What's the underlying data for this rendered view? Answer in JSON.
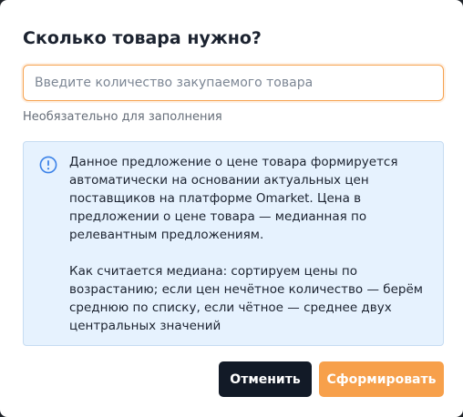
{
  "dialog": {
    "title": "Сколько товара нужно?",
    "quantity_input": {
      "value": "",
      "placeholder": "Введите количество закупаемого товара"
    },
    "hint": "Необязательно для заполнения",
    "info": {
      "icon": "alert-circle-icon",
      "paragraph_1": "Данное предложение о цене товара формируется\nавтоматически на основании актуальных цен\nпоставщиков на платформе Omarket. Цена в\nпредложении о цене товара — медианная по\nрелевантным предложениям.",
      "paragraph_2": "Как считается медиана: сортируем цены по\nвозрастанию; если цен нечётное количество — берём\nсреднюю по списку, если чётное — среднее двух\nцентральных значений"
    },
    "buttons": {
      "cancel_label": "Отменить",
      "submit_label": "Сформировать"
    }
  },
  "colors": {
    "accent": "#f7a04b",
    "dark_button": "#121a27",
    "info_background": "#e6f2fe",
    "info_icon": "#3b82e8"
  }
}
